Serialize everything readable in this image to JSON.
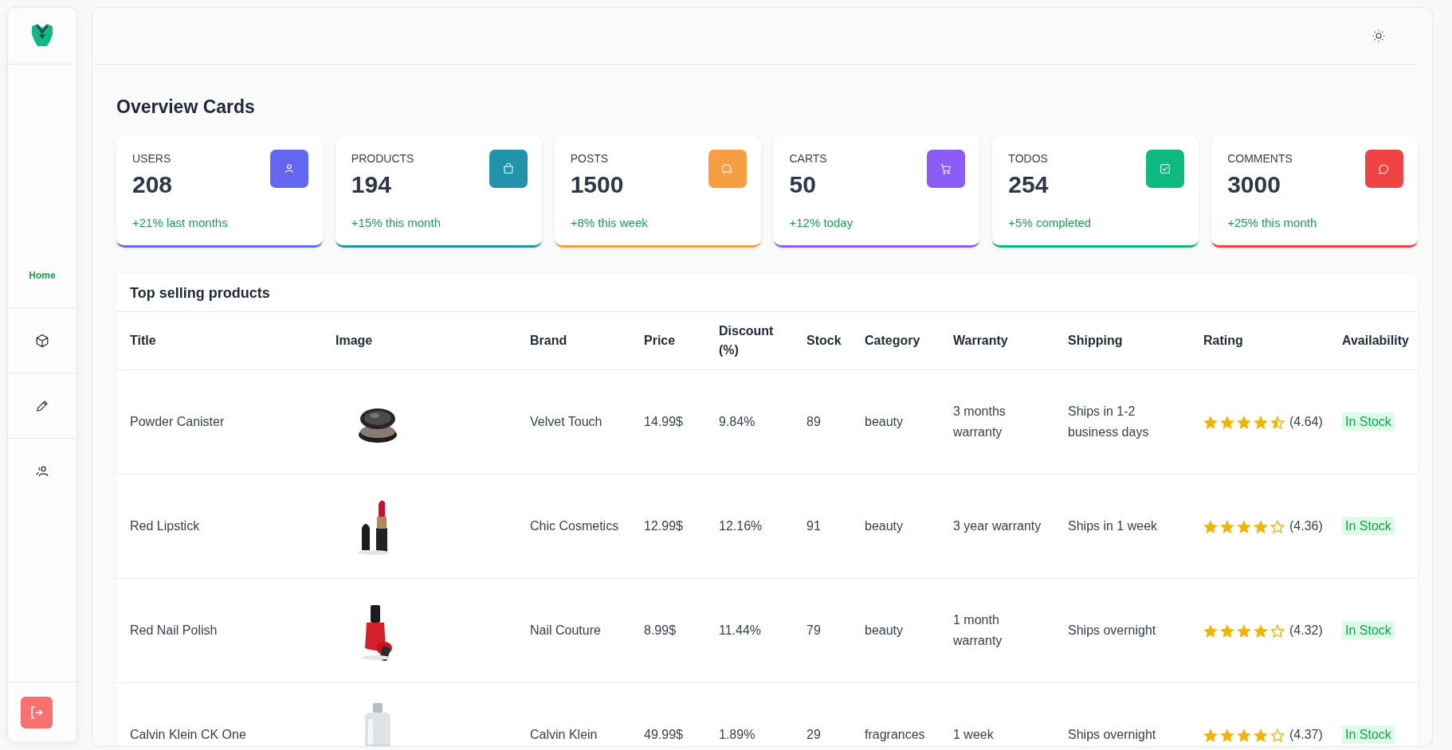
{
  "sidebar": {
    "items": [
      {
        "label": "Home",
        "selected": true
      },
      {
        "selected": false
      },
      {
        "selected": false
      },
      {
        "selected": false
      }
    ]
  },
  "page_title": "Overview Cards",
  "cards": [
    {
      "label": "USERS",
      "value": "208",
      "change": "+21% last months",
      "color": "#6366f1"
    },
    {
      "label": "PRODUCTS",
      "value": "194",
      "change": "+15% this month",
      "color": "#2193ab"
    },
    {
      "label": "POSTS",
      "value": "1500",
      "change": "+8% this week",
      "color": "#f59e42"
    },
    {
      "label": "CARTS",
      "value": "50",
      "change": "+12% today",
      "color": "#8b5cf6"
    },
    {
      "label": "TODOS",
      "value": "254",
      "change": "+5% completed",
      "color": "#10b981"
    },
    {
      "label": "COMMENTS",
      "value": "3000",
      "change": "+25% this month",
      "color": "#ef4444"
    }
  ],
  "table": {
    "title": "Top selling products",
    "columns": [
      "Title",
      "Image",
      "Brand",
      "Price",
      "Discount (%)",
      "Stock",
      "Category",
      "Warranty",
      "Shipping",
      "Rating",
      "Availability"
    ],
    "rows": [
      {
        "title": "Powder Canister",
        "brand": "Velvet Touch",
        "price": "14.99$",
        "discount": "9.84%",
        "stock": "89",
        "category": "beauty",
        "warranty": "3 months warranty",
        "shipping": "Ships in 1-2 business days",
        "stars": 4.5,
        "rating": "(4.64)",
        "availability": "In Stock"
      },
      {
        "title": "Red Lipstick",
        "brand": "Chic Cosmetics",
        "price": "12.99$",
        "discount": "12.16%",
        "stock": "91",
        "category": "beauty",
        "warranty": "3 year warranty",
        "shipping": "Ships in 1 week",
        "stars": 4,
        "rating": "(4.36)",
        "availability": "In Stock"
      },
      {
        "title": "Red Nail Polish",
        "brand": "Nail Couture",
        "price": "8.99$",
        "discount": "11.44%",
        "stock": "79",
        "category": "beauty",
        "warranty": "1 month warranty",
        "shipping": "Ships overnight",
        "stars": 4,
        "rating": "(4.32)",
        "availability": "In Stock"
      },
      {
        "title": "Calvin Klein CK One",
        "brand": "Calvin Klein",
        "price": "49.99$",
        "discount": "1.89%",
        "stock": "29",
        "category": "fragrances",
        "warranty": "1 week",
        "shipping": "Ships overnight",
        "stars": 4,
        "rating": "(4.37)",
        "availability": "In Stock"
      }
    ]
  }
}
